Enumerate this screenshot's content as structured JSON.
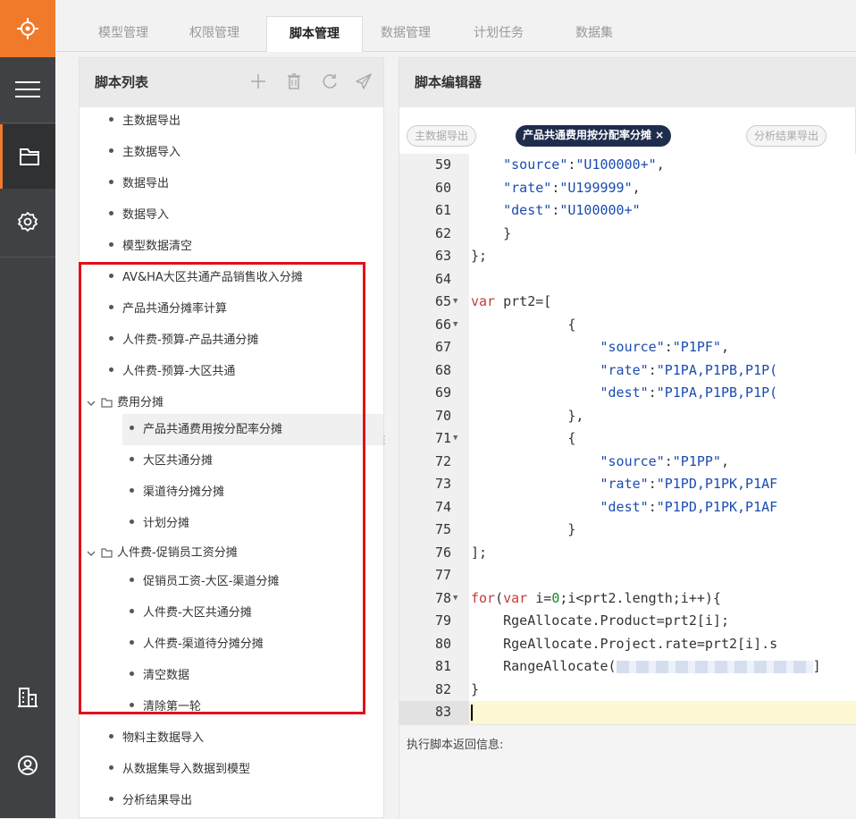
{
  "nav_tabs": [
    "模型管理",
    "权限管理",
    "脚本管理",
    "数据管理",
    "计划任务",
    "数据集"
  ],
  "active_tab": "脚本管理",
  "sidebar_icons": [
    "logo-icon",
    "menu-icon",
    "folder-icon",
    "settings-icon",
    "building-icon",
    "user-icon"
  ],
  "script_list": {
    "title": "脚本列表",
    "top_items": [
      "主数据导出",
      "主数据导入",
      "数据导出",
      "数据导入",
      "模型数据清空",
      "AV&HA大区共通产品销售收入分摊",
      "产品共通分摊率计算",
      "人件费-预算-产品共通分摊",
      "人件费-预算-大区共通"
    ],
    "folder1": {
      "name": "费用分摊",
      "items": [
        "产品共通费用按分配率分摊",
        "大区共通分摊",
        "渠道待分摊分摊",
        "计划分摊"
      ]
    },
    "folder2": {
      "name": "人件费-促销员工资分摊",
      "items": [
        "促销员工资-大区-渠道分摊",
        "人件费-大区共通分摊",
        "人件费-渠道待分摊分摊",
        "清空数据",
        "清除第一轮"
      ]
    },
    "bottom_items": [
      "物料主数据导入",
      "从数据集导入数据到模型",
      "分析结果导出"
    ]
  },
  "editor": {
    "title": "脚本编辑器",
    "file_tabs": [
      "主数据导出",
      "产品共通费用按分配率分摊 ×",
      "分析结果导出"
    ],
    "line_numbers": [
      "59",
      "60",
      "61",
      "62",
      "63",
      "64",
      "65",
      "66",
      "67",
      "68",
      "69",
      "70",
      "71",
      "72",
      "73",
      "74",
      "75",
      "76",
      "77",
      "78",
      "79",
      "80",
      "81",
      "82",
      "83"
    ],
    "code": {
      "l59_key": "\"source\"",
      "l59_val": "\"U100000+\"",
      "l60_key": "\"rate\"",
      "l60_val": "\"U199999\"",
      "l61_key": "\"dest\"",
      "l61_val": "\"U100000+\"",
      "l62": "}",
      "l63": "};",
      "l65_kw": "var",
      "l65_rest": " prt2=[",
      "l66": "{",
      "l67_key": "\"source\"",
      "l67_val": "\"P1PF\"",
      "l68_key": "\"rate\"",
      "l68_val": "\"P1PA,P1PB,P1P(",
      "l69_key": "\"dest\"",
      "l69_val": "\"P1PA,P1PB,P1P(",
      "l70": "},",
      "l71": "{",
      "l72_key": "\"source\"",
      "l72_val": "\"P1PP\"",
      "l73_key": "\"rate\"",
      "l73_val": "\"P1PD,P1PK,P1AF",
      "l74_key": "\"dest\"",
      "l74_val": "\"P1PD,P1PK,P1AF",
      "l75": "}",
      "l76": "];",
      "l78_kw1": "for",
      "l78_p1": "(",
      "l78_kw2": "var",
      "l78_p2": " i=",
      "l78_num": "0",
      "l78_p3": ";i<prt2.length;i++){",
      "l79": "RgeAllocate.Product=prt2[i];",
      "l80": "RgeAllocate.Project.rate=prt2[i].s",
      "l81_a": "RangeAllocate(",
      "l81_b": "]",
      "l82": "}"
    },
    "return_label": "执行脚本返回信息:"
  }
}
